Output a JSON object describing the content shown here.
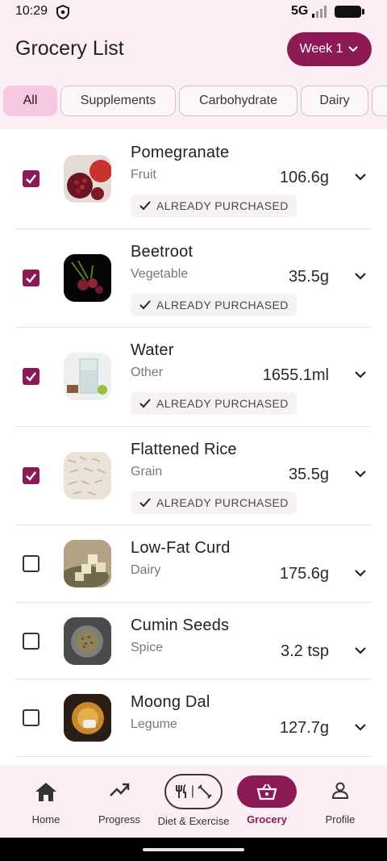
{
  "status": {
    "time": "10:29",
    "network": "5G"
  },
  "header": {
    "title": "Grocery List",
    "week_label": "Week 1"
  },
  "filters": [
    "All",
    "Supplements",
    "Carbohydrate",
    "Dairy",
    ""
  ],
  "items": [
    {
      "name": "Pomegranate",
      "category": "Fruit",
      "quantity": "106.6g",
      "purchased": true,
      "purchased_label": "ALREADY PURCHASED"
    },
    {
      "name": "Beetroot",
      "category": "Vegetable",
      "quantity": "35.5g",
      "purchased": true,
      "purchased_label": "ALREADY PURCHASED"
    },
    {
      "name": "Water",
      "category": "Other",
      "quantity": "1655.1ml",
      "purchased": true,
      "purchased_label": "ALREADY PURCHASED"
    },
    {
      "name": "Flattened Rice",
      "category": "Grain",
      "quantity": "35.5g",
      "purchased": true,
      "purchased_label": "ALREADY PURCHASED"
    },
    {
      "name": "Low-Fat Curd",
      "category": "Dairy",
      "quantity": "175.6g",
      "purchased": false
    },
    {
      "name": "Cumin Seeds",
      "category": "Spice",
      "quantity": "3.2 tsp",
      "purchased": false
    },
    {
      "name": "Moong Dal",
      "category": "Legume",
      "quantity": "127.7g",
      "purchased": false
    }
  ],
  "nav": [
    {
      "label": "Home",
      "icon": "home-icon"
    },
    {
      "label": "Progress",
      "icon": "trending-up-icon"
    },
    {
      "label": "Diet & Exercise",
      "icon": "cutlery-exercise-icon"
    },
    {
      "label": "Grocery",
      "icon": "basket-icon",
      "active": true
    },
    {
      "label": "Profile",
      "icon": "person-icon"
    }
  ],
  "colors": {
    "accent": "#8b1a55",
    "chip_active": "#f7c8e1",
    "background": "#fdf4f8"
  }
}
